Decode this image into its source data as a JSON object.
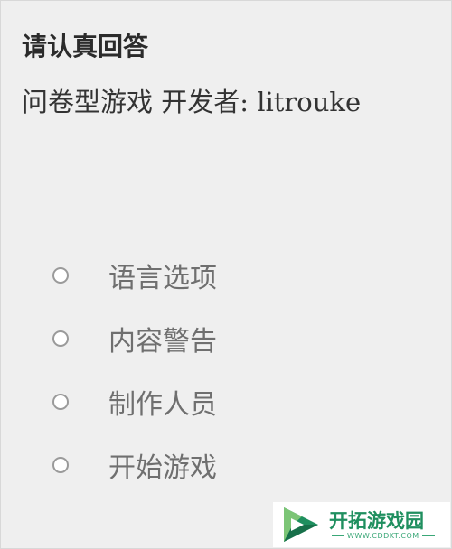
{
  "header": {
    "title": "请认真回答",
    "subtitle": "问卷型游戏 开发者: litrouke"
  },
  "menu": {
    "items": [
      {
        "label": "语言选项"
      },
      {
        "label": "内容警告"
      },
      {
        "label": "制作人员"
      },
      {
        "label": "开始游戏"
      }
    ]
  },
  "watermark": {
    "name": "开拓游戏园",
    "domain": "WWW.CDDKT.COM",
    "icon": "play-logo-icon",
    "colors": {
      "primary": "#1f8f5f",
      "secondary": "#7cc576"
    }
  },
  "colors": {
    "background": "#efefef",
    "title": "#2b2b2b",
    "menu_text": "#6f6f6f",
    "radio_border": "#9a9a9a"
  }
}
